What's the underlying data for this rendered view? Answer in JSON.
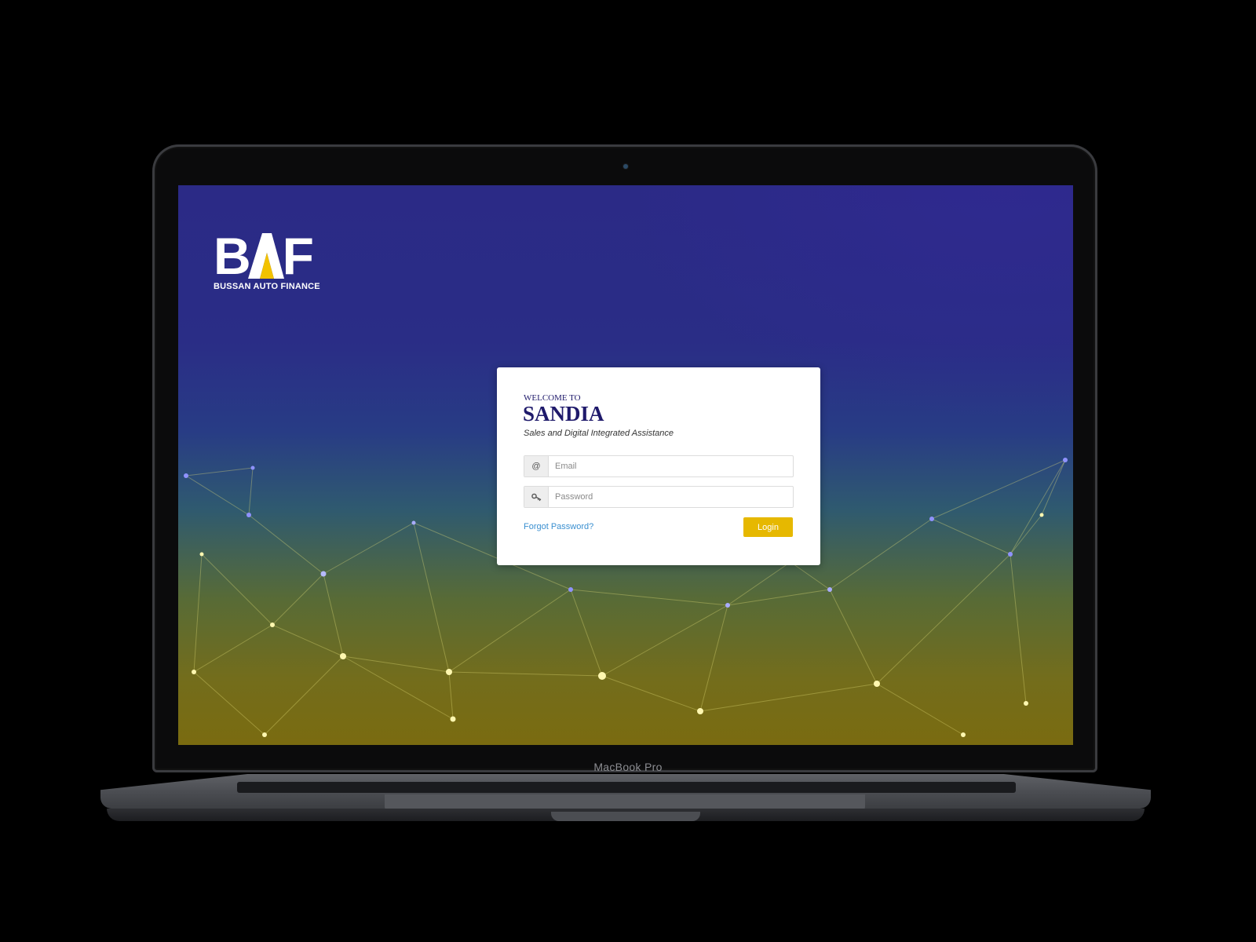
{
  "device": {
    "label": "MacBook Pro"
  },
  "brand": {
    "logo_text": "BAF",
    "tagline": "BUSSAN AUTO FINANCE",
    "accent_color": "#F2C200"
  },
  "login": {
    "welcome": "WELCOME TO",
    "title": "SANDIA",
    "subtitle": "Sales and Digital Integrated Assistance",
    "email": {
      "icon": "at-icon",
      "icon_glyph": "@",
      "value": "",
      "placeholder": "Email"
    },
    "password": {
      "icon": "key-icon",
      "value": "",
      "placeholder": "Password"
    },
    "forgot_label": "Forgot Password?",
    "login_label": "Login"
  },
  "colors": {
    "title": "#1F1A6B",
    "link": "#3A8FD0",
    "button": "#E6B800",
    "background_top": "#2B2A86",
    "background_bottom": "#7A6B10"
  }
}
